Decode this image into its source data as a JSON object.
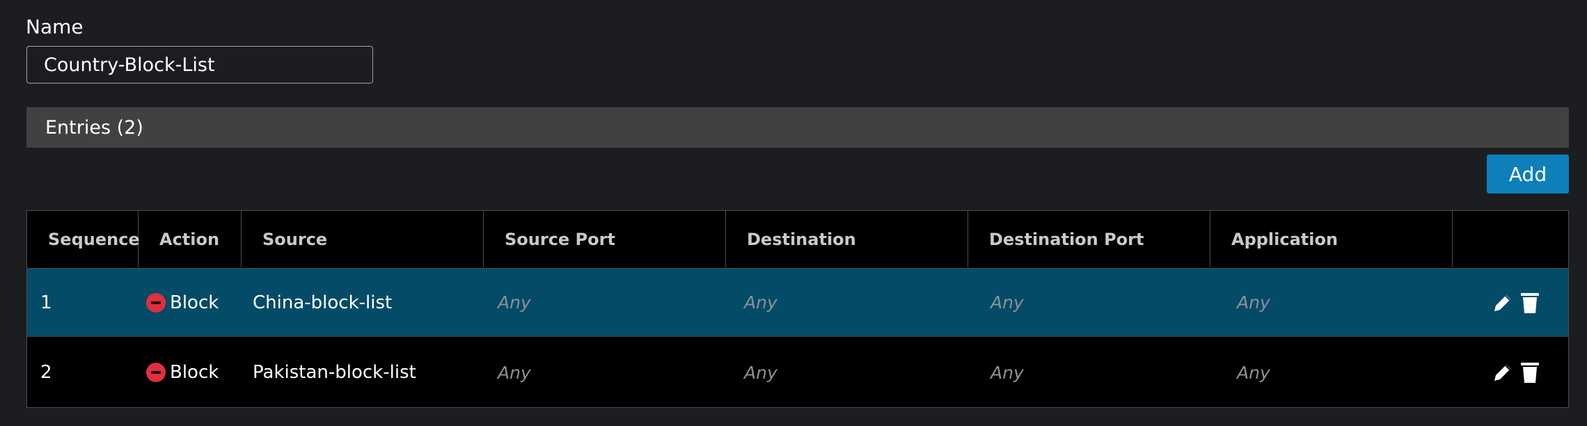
{
  "form": {
    "name_label": "Name",
    "name_value": "Country-Block-List"
  },
  "entries": {
    "title": "Entries (2)",
    "add_label": "Add"
  },
  "table": {
    "columns": [
      "Sequence",
      "Action",
      "Source",
      "Source Port",
      "Destination",
      "Destination Port",
      "Application"
    ],
    "rows": [
      {
        "sequence": "1",
        "action": "Block",
        "source": "China-block-list",
        "source_port": "Any",
        "destination": "Any",
        "destination_port": "Any",
        "application": "Any",
        "selected": true
      },
      {
        "sequence": "2",
        "action": "Block",
        "source": "Pakistan-block-list",
        "source_port": "Any",
        "destination": "Any",
        "destination_port": "Any",
        "application": "Any",
        "selected": false
      }
    ]
  },
  "icons": {
    "block": "block-icon",
    "edit": "pencil-icon",
    "delete": "trash-icon"
  },
  "colors": {
    "background": "#1c1d21",
    "selected_row": "#034b67",
    "add_button": "#0d7fbb",
    "block_icon": "#e02f3d",
    "entries_bar": "#414141"
  }
}
